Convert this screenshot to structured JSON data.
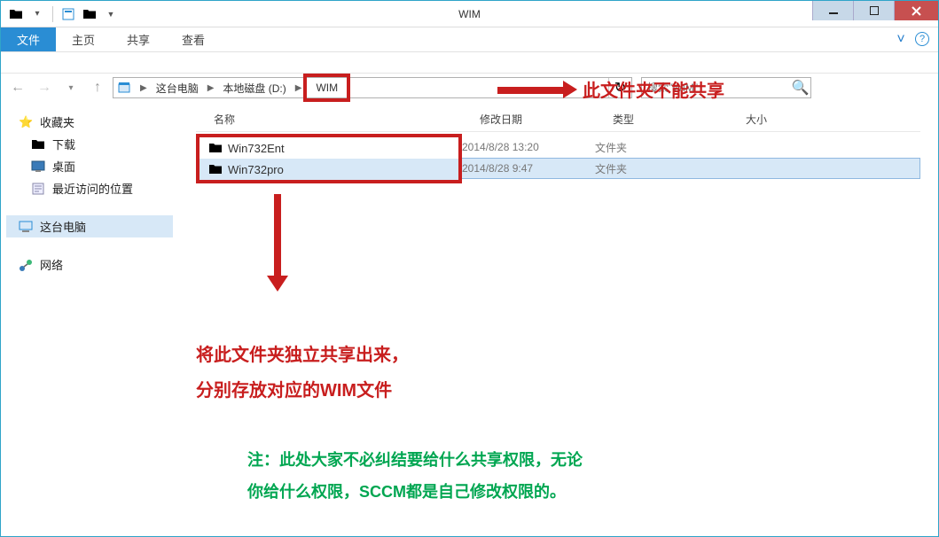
{
  "window": {
    "title": "WIM"
  },
  "ribbon": {
    "file": "文件",
    "tabs": [
      "主页",
      "共享",
      "查看"
    ]
  },
  "nav": {
    "crumbs": [
      "这台电脑",
      "本地磁盘 (D:)",
      "WIM"
    ],
    "search_placeholder": "搜索\"WIM\""
  },
  "sidebar": {
    "favorites": {
      "label": "收藏夹",
      "items": [
        "下载",
        "桌面",
        "最近访问的位置"
      ]
    },
    "computer": {
      "label": "这台电脑"
    },
    "network": {
      "label": "网络"
    }
  },
  "columns": {
    "name": "名称",
    "date": "修改日期",
    "type": "类型",
    "size": "大小"
  },
  "files": [
    {
      "name": "Win732Ent",
      "date": "2014/8/28 13:20",
      "type": "文件夹"
    },
    {
      "name": "Win732pro",
      "date": "2014/8/28 9:47",
      "type": "文件夹"
    }
  ],
  "annotations": {
    "a1": "此文件夹不能共享",
    "a2_line1": "将此文件夹独立共享出来，",
    "a2_line2": "分别存放对应的WIM文件",
    "a3_line1": "注：此处大家不必纠结要给什么共享权限，无论",
    "a3_line2": "你给什么权限，SCCM都是自己修改权限的。"
  }
}
